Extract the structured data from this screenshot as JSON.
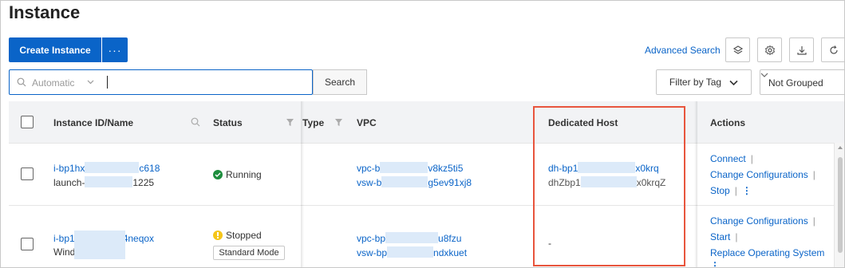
{
  "page_title": "Instance",
  "toolbar": {
    "create_label": "Create Instance",
    "more_label": "···",
    "advanced_search_label": "Advanced Search",
    "icons": [
      "layers-icon",
      "gear-icon",
      "download-icon",
      "refresh-icon"
    ]
  },
  "search": {
    "selector_value": "Automatic",
    "input_value": "",
    "button_label": "Search"
  },
  "filters": {
    "filter_by_tag_label": "Filter by Tag",
    "group_value": "Not Grouped"
  },
  "table": {
    "columns": {
      "instance": "Instance ID/Name",
      "status": "Status",
      "type": "Type",
      "vpc": "VPC",
      "dedicated_host": "Dedicated Host",
      "actions": "Actions"
    },
    "rows": [
      {
        "instance_id": "i-bp1hx",
        "instance_id_tail": "c618",
        "instance_name": "launch-",
        "instance_name_tail": "1225",
        "status": "Running",
        "vpc_id": "vpc-b",
        "vpc_id_tail": "v8kz5ti5",
        "vswitch_id": "vsw-b",
        "vswitch_id_tail": "g5ev91xj8",
        "host_id": "dh-bp1",
        "host_id_tail": "x0krq",
        "host_name": "dhZbp1",
        "host_name_tail": "x0krqZ",
        "actions": [
          "Connect",
          "Change Configurations",
          "Stop"
        ]
      },
      {
        "instance_id": "i-bp1",
        "instance_id_tail": "4neqox",
        "instance_name": "Wind",
        "status": "Stopped",
        "mode": "Standard Mode",
        "vpc_id": "vpc-bp",
        "vpc_id_tail": "u8fzu",
        "vswitch_id": "vsw-bp",
        "vswitch_id_tail": "ndxkuet",
        "host": "-",
        "actions": [
          "Change Configurations",
          "Start",
          "Replace Operating System"
        ]
      }
    ]
  },
  "colors": {
    "primary": "#0a64c8",
    "running": "#1e8e3e",
    "stopped": "#f5c518",
    "highlight": "#e8553d"
  }
}
